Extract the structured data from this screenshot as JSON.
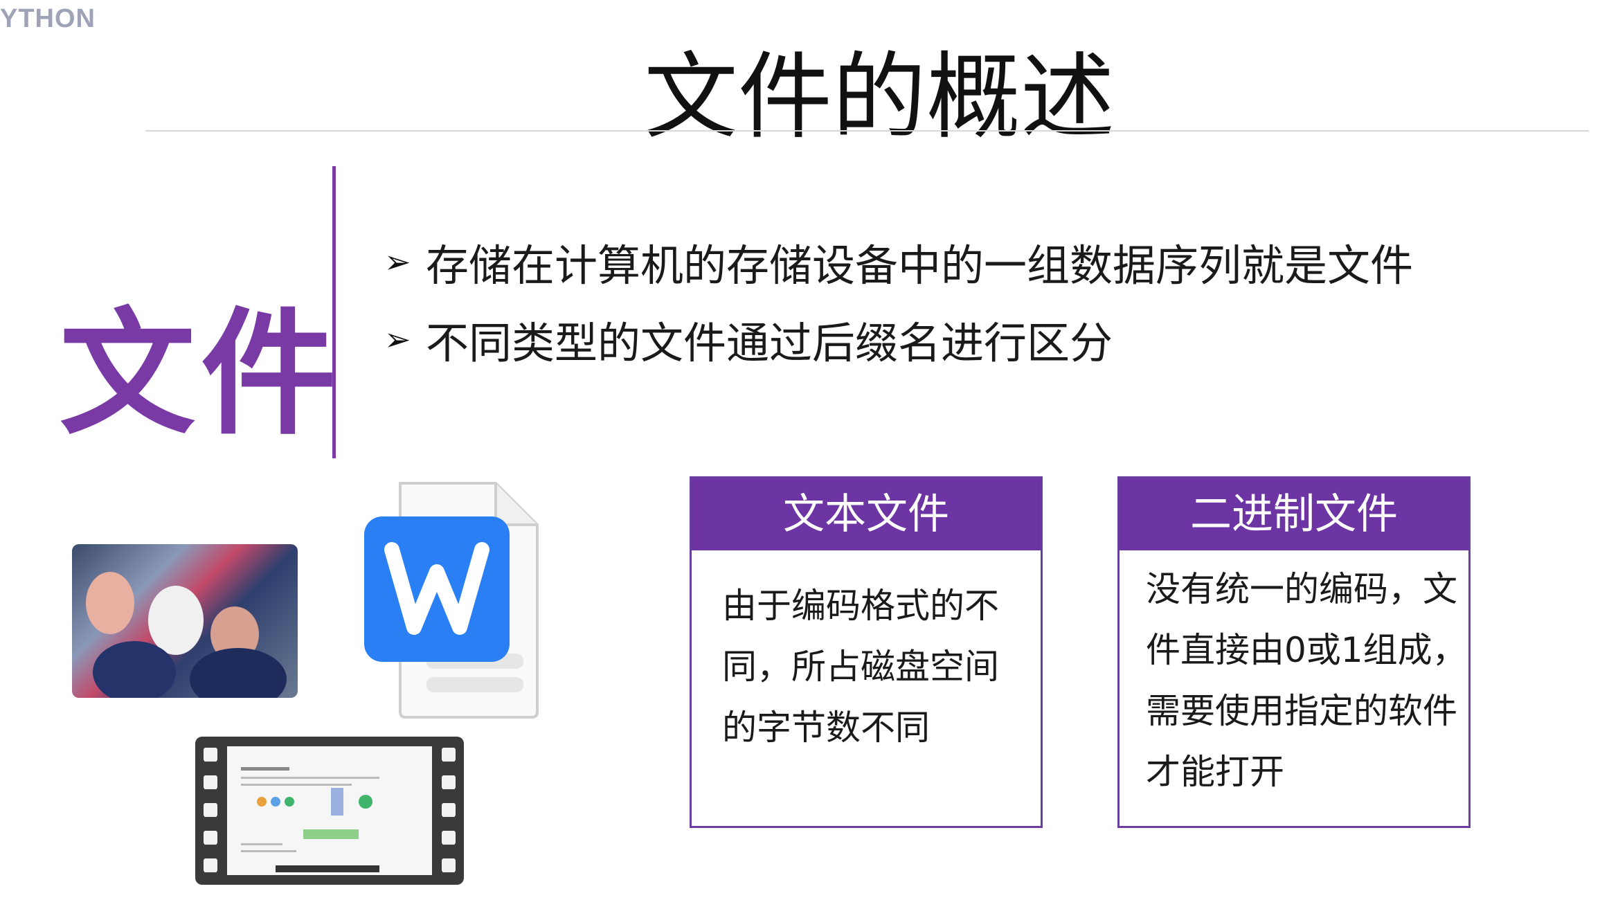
{
  "corner_logo": "YTHON",
  "title": "文件的概述",
  "big_word": "文件",
  "bullets": [
    "存储在计算机的存储设备中的一组数据序列就是文件",
    "不同类型的文件通过后缀名进行区分"
  ],
  "bullet_glyph": "➢",
  "cards": [
    {
      "heading": "文本文件",
      "lines": [
        "由于编码格式的不",
        "同，所占磁盘空间",
        "的字节数不同"
      ]
    },
    {
      "heading": "二进制文件",
      "lines": [
        "没有统一的编码，文",
        "件直接由0或1组成，",
        "需要使用指定的软件",
        "才能打开"
      ]
    }
  ],
  "colors": {
    "accent": "#6d35a3",
    "rule": "#d9d9d9",
    "logo": "#9ea3b8"
  },
  "icons": [
    "photo-thumbnail",
    "word-document-icon",
    "video-film-icon"
  ]
}
